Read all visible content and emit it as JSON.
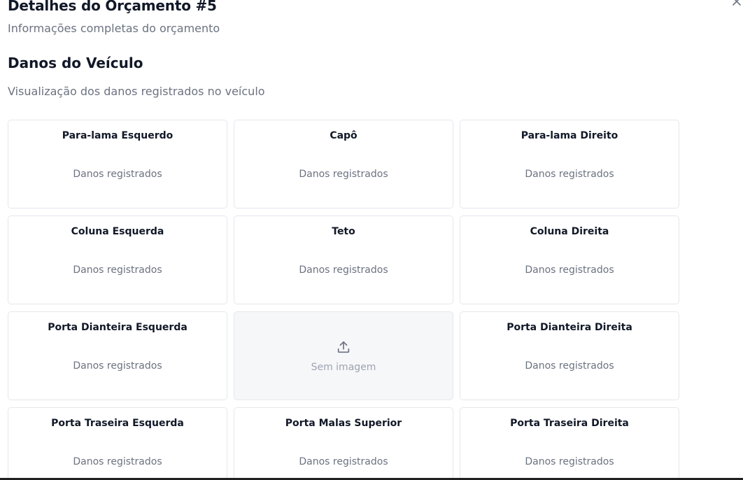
{
  "dialog": {
    "title": "Detalhes do Orçamento #5",
    "subtitle": "Informações completas do orçamento"
  },
  "section": {
    "title": "Danos do Veículo",
    "description": "Visualização dos danos registrados no veículo"
  },
  "cards": [
    {
      "title": "Para-lama Esquerdo",
      "status": "Danos registrados"
    },
    {
      "title": "Capô",
      "status": "Danos registrados"
    },
    {
      "title": "Para-lama Direito",
      "status": "Danos registrados"
    },
    {
      "title": "Coluna Esquerda",
      "status": "Danos registrados"
    },
    {
      "title": "Teto",
      "status": "Danos registrados"
    },
    {
      "title": "Coluna Direita",
      "status": "Danos registrados"
    },
    {
      "title": "Porta Dianteira Esquerda",
      "status": "Danos registrados"
    },
    {
      "empty_label": "Sem imagem",
      "icon": "upload-icon"
    },
    {
      "title": "Porta Dianteira Direita",
      "status": "Danos registrados"
    },
    {
      "title": "Porta Traseira Esquerda",
      "status": "Danos registrados"
    },
    {
      "title": "Porta Malas Superior",
      "status": "Danos registrados"
    },
    {
      "title": "Porta Traseira Direita",
      "status": "Danos registrados"
    }
  ],
  "icons": {
    "close": "close-icon"
  }
}
